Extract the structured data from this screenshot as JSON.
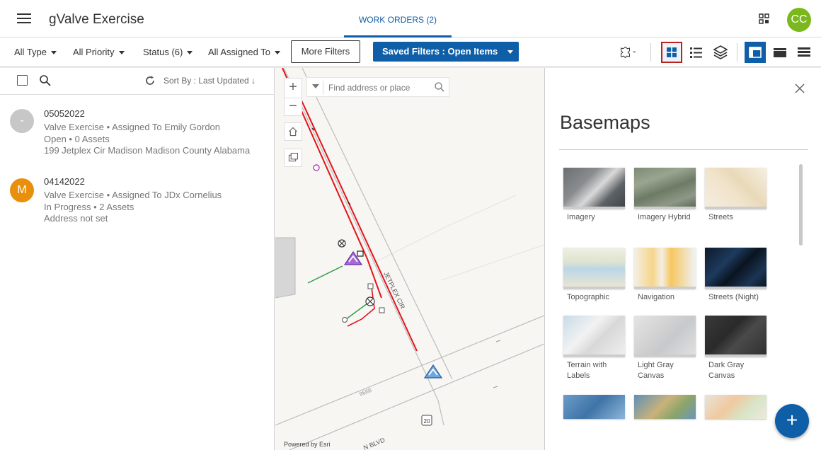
{
  "header": {
    "app_title": "gValve Exercise",
    "tab_work_orders": "WORK ORDERS (2)",
    "user_initials": "CC",
    "user_color": "#7ab81d"
  },
  "filters": {
    "type": "All Type",
    "priority": "All Priority",
    "status": "Status (6)",
    "assigned": "All Assigned To",
    "more_filters": "More Filters",
    "saved_filters": "Saved Filters : Open Items"
  },
  "list": {
    "sort_label": "Sort By : Last Updated",
    "items": [
      {
        "avatar": "-",
        "avatar_color": "#c7c7c7",
        "id": "05052022",
        "line1": "Valve Exercise • Assigned To Emily Gordon",
        "line2": "Open • 0 Assets",
        "line3": "199 Jetplex Cir Madison Madison County Alabama"
      },
      {
        "avatar": "M",
        "avatar_color": "#e8900c",
        "id": "04142022",
        "line1": "Valve Exercise • Assigned To JDx Cornelius",
        "line2": "In Progress • 2 Assets",
        "line3": "Address not set"
      }
    ]
  },
  "map": {
    "search_placeholder": "Find address or place",
    "powered_by": "Powered by Esri",
    "street_jetplex": "JETPLEX CIR",
    "street_blvd": "N BLVD",
    "label_9668": "9668",
    "route_20": "20"
  },
  "basemaps": {
    "title": "Basemaps",
    "items": [
      {
        "label": "Imagery"
      },
      {
        "label": "Imagery Hybrid"
      },
      {
        "label": "Streets"
      },
      {
        "label": "Topographic"
      },
      {
        "label": "Navigation"
      },
      {
        "label": "Streets (Night)"
      },
      {
        "label": "Terrain with Labels"
      },
      {
        "label": "Light Gray Canvas"
      },
      {
        "label": "Dark Gray Canvas"
      }
    ]
  },
  "fab_label": "+",
  "colors": {
    "accent": "#0f5ea8",
    "pipe_red": "#e3141b",
    "pipe_green": "#2e9e4a"
  }
}
